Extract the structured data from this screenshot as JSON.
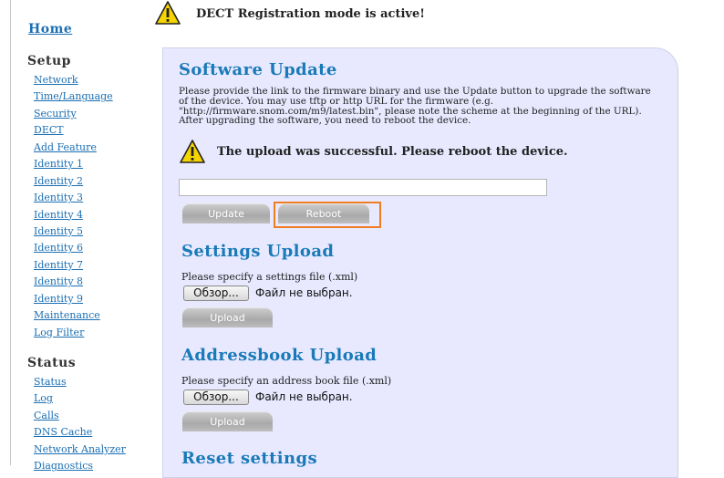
{
  "banner": {
    "text": "DECT Registration mode is active!",
    "icon": "warning-icon"
  },
  "sidebar": {
    "home": "Home",
    "setup_title": "Setup",
    "setup_items": [
      "Network",
      "Time/Language",
      "Security",
      "DECT",
      "Add Feature",
      "Identity 1",
      "Identity 2",
      "Identity 3",
      "Identity 4",
      "Identity 5",
      "Identity 6",
      "Identity 7",
      "Identity 8",
      "Identity 9",
      "Maintenance",
      "Log Filter"
    ],
    "status_title": "Status",
    "status_items": [
      "Status",
      "Log",
      "Calls",
      "DNS Cache",
      "Network Analyzer",
      "Diagnostics"
    ]
  },
  "software_update": {
    "title": "Software Update",
    "description": "Please provide the link to the firmware binary and use the Update button to upgrade the software of the device. You may use tftp or http URL for the firmware (e.g. \"http://firmware.snom.com/m9/latest.bin\", please note the scheme at the beginning of the URL). After upgrading the software, you need to reboot the device.",
    "notice": "The upload was successful. Please reboot the device.",
    "notice_icon": "warning-icon",
    "url_value": "",
    "update_label": "Update",
    "reboot_label": "Reboot"
  },
  "settings_upload": {
    "title": "Settings Upload",
    "prompt": "Please specify a settings file (.xml)",
    "browse_label": "Обзор...",
    "file_status": "Файл не выбран.",
    "upload_label": "Upload"
  },
  "addressbook_upload": {
    "title": "Addressbook Upload",
    "prompt": "Please specify an address book file (.xml)",
    "browse_label": "Обзор...",
    "file_status": "Файл не выбран.",
    "upload_label": "Upload"
  },
  "reset_settings": {
    "title": "Reset settings"
  },
  "colors": {
    "link": "#1a6fb3",
    "heading": "#1a7ab8",
    "panel_bg": "#e8e9ff",
    "highlight": "#ef7d22"
  }
}
